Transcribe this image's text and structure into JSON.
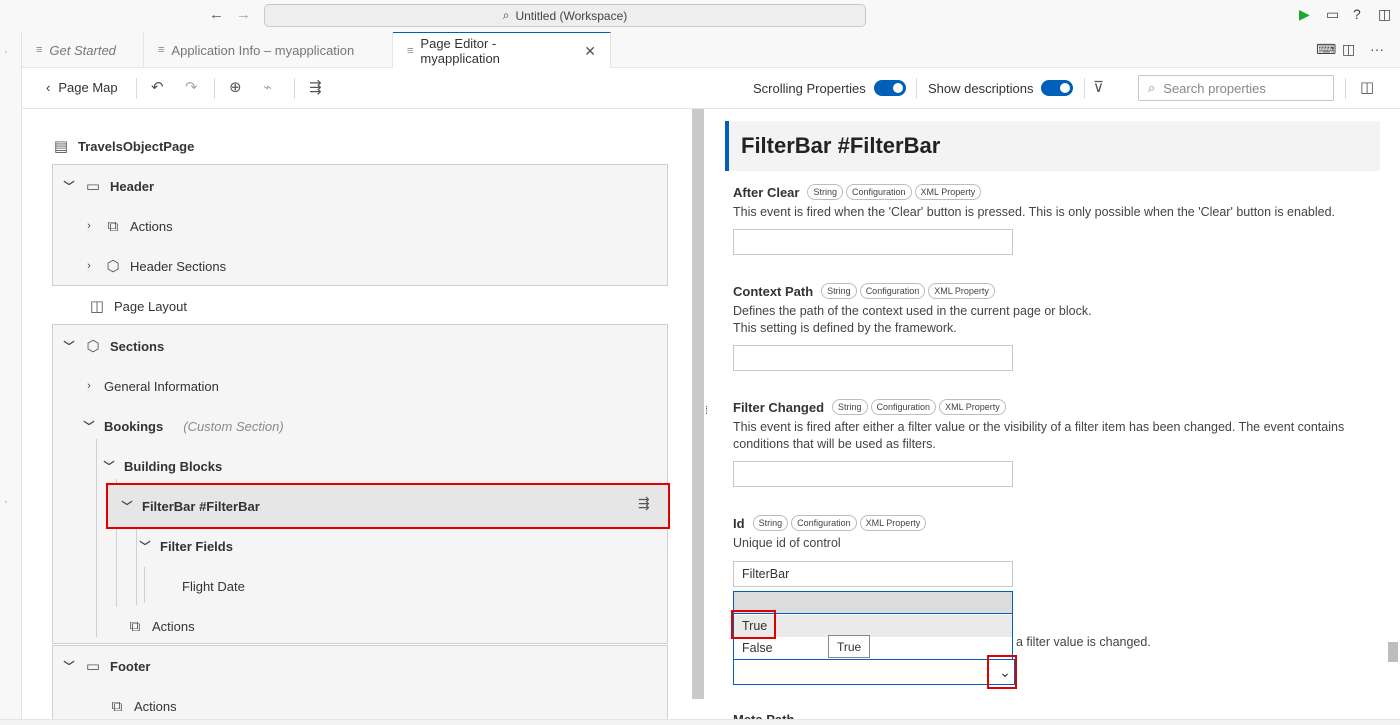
{
  "titlebar": {
    "back": "←",
    "forward": "→",
    "search_icon": "⌕",
    "workspace": "Untitled (Workspace)",
    "run_icon": "▶",
    "layout_icon": "▭",
    "help_icon": "?",
    "panel_icon": "◫",
    "run_color": "#1ca62b"
  },
  "tabs": [
    {
      "label": "Get Started",
      "icon": "≡"
    },
    {
      "label": "Application Info – myapplication",
      "icon": "≡"
    },
    {
      "label": "Page Editor - myapplication",
      "icon": "≡",
      "close": "✕"
    }
  ],
  "tab_actions": {
    "terminal": "⌨",
    "split": "◫",
    "more": "···"
  },
  "toolbar": {
    "back_chevron": "‹",
    "page_map": "Page Map",
    "undo": "↶",
    "redo": "↷",
    "globe": "⊕",
    "brush": "⌁",
    "outline": "⇶",
    "scrolling_label": "Scrolling Properties",
    "descriptions_label": "Show descriptions",
    "filter": "⊽",
    "search_placeholder": "Search properties",
    "panel_toggle": "◫",
    "toggle_color": "#005fb8"
  },
  "tree": {
    "root": "TravelsObjectPage",
    "header": "Header",
    "header_actions": "Actions",
    "header_sections": "Header Sections",
    "page_layout": "Page Layout",
    "sections": "Sections",
    "general_info": "General Information",
    "bookings": "Bookings",
    "custom_section": "(Custom Section)",
    "building_blocks": "Building Blocks",
    "filterbar": "FilterBar #FilterBar",
    "filter_fields": "Filter Fields",
    "flight_date": "Flight Date",
    "fb_actions": "Actions",
    "footer": "Footer",
    "footer_actions": "Actions",
    "row_action_icon": "⇶",
    "highlight_color": "#e00000"
  },
  "props": {
    "section_title": "FilterBar #FilterBar",
    "after_clear": {
      "name": "After Clear",
      "tags": [
        "String",
        "Configuration",
        "XML Property"
      ],
      "desc": "This event is fired when the 'Clear' button is pressed. This is only possible when the 'Clear' button is enabled.",
      "value": ""
    },
    "context_path": {
      "name": "Context Path",
      "tags": [
        "String",
        "Configuration",
        "XML Property"
      ],
      "desc1": "Defines the path of the context used in the current page or block.",
      "desc2": "This setting is defined by the framework.",
      "value": ""
    },
    "filter_changed": {
      "name": "Filter Changed",
      "tags": [
        "String",
        "Configuration",
        "XML Property"
      ],
      "desc": "This event is fired after either a filter value or the visibility of a filter item has been changed. The event contains conditions that will be used as filters.",
      "value": ""
    },
    "id": {
      "name": "Id",
      "tags": [
        "String",
        "Configuration",
        "XML Property"
      ],
      "desc": "Unique id of control",
      "value": "FilterBar"
    },
    "live_mode_desc_tail": "a filter value is changed.",
    "dropdown_options": [
      "True",
      "False"
    ],
    "tooltip": "True",
    "select_chevron": "⌄",
    "next_prop": "Meta Path"
  }
}
